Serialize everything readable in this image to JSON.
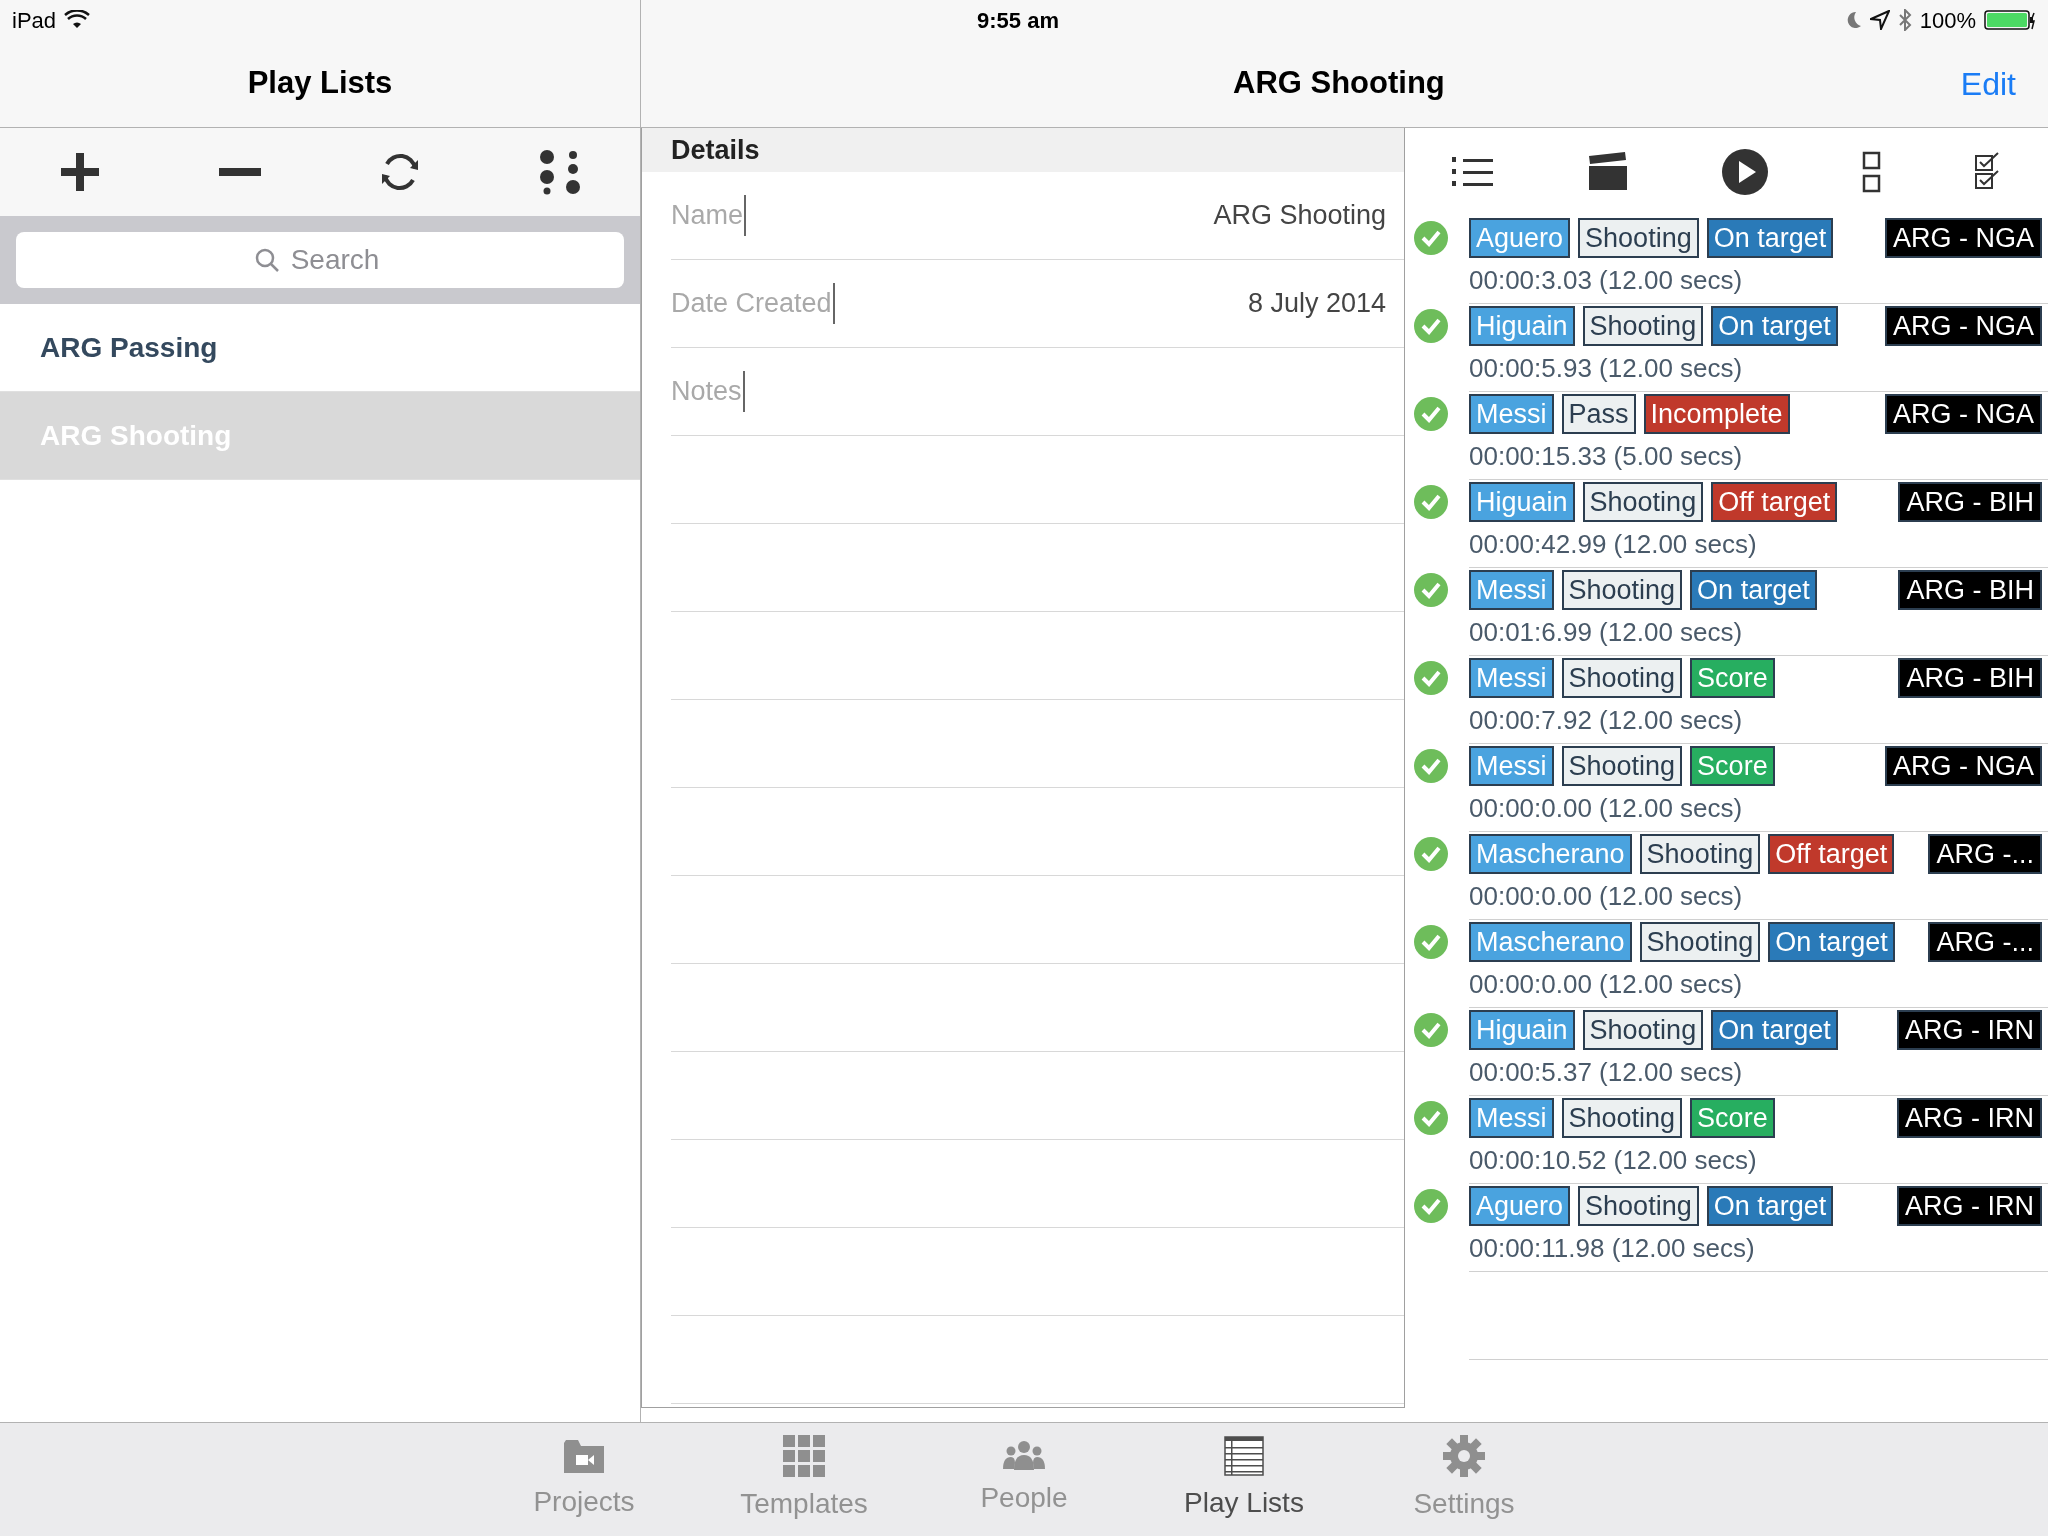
{
  "status_bar": {
    "device": "iPad",
    "time": "9:55 am",
    "battery": "100%"
  },
  "left_nav": {
    "title": "Play Lists"
  },
  "right_nav": {
    "title": "ARG Shooting",
    "edit": "Edit"
  },
  "search": {
    "placeholder": "Search"
  },
  "playlists": [
    {
      "label": "ARG Passing",
      "selected": false
    },
    {
      "label": "ARG Shooting",
      "selected": true
    }
  ],
  "details": {
    "header": "Details",
    "fields": [
      {
        "label": "Name",
        "value": "ARG Shooting"
      },
      {
        "label": "Date Created",
        "value": "8 July 2014"
      },
      {
        "label": "Notes"
      }
    ]
  },
  "events": [
    {
      "checked": true,
      "tags": [
        {
          "kind": "player",
          "text": "Aguero"
        },
        {
          "kind": "action",
          "text": "Shooting"
        },
        {
          "kind": "result",
          "text": "On target",
          "color": "#2a7ab8"
        }
      ],
      "match": "ARG - NGA",
      "time": "00:00:3.03 (12.00 secs)"
    },
    {
      "checked": true,
      "tags": [
        {
          "kind": "player",
          "text": "Higuain"
        },
        {
          "kind": "action",
          "text": "Shooting"
        },
        {
          "kind": "result",
          "text": "On target",
          "color": "#2a7ab8"
        }
      ],
      "match": "ARG - NGA",
      "time": "00:00:5.93 (12.00 secs)"
    },
    {
      "checked": true,
      "tags": [
        {
          "kind": "player",
          "text": "Messi"
        },
        {
          "kind": "action",
          "text": "Pass"
        },
        {
          "kind": "result",
          "text": "Incomplete",
          "color": "#c0392b"
        }
      ],
      "match": "ARG - NGA",
      "time": "00:00:15.33 (5.00 secs)"
    },
    {
      "checked": true,
      "tags": [
        {
          "kind": "player",
          "text": "Higuain"
        },
        {
          "kind": "action",
          "text": "Shooting"
        },
        {
          "kind": "result",
          "text": "Off target",
          "color": "#c0392b"
        }
      ],
      "match": "ARG - BIH",
      "time": "00:00:42.99 (12.00 secs)"
    },
    {
      "checked": true,
      "tags": [
        {
          "kind": "player",
          "text": "Messi"
        },
        {
          "kind": "action",
          "text": "Shooting"
        },
        {
          "kind": "result",
          "text": "On target",
          "color": "#2a7ab8"
        }
      ],
      "match": "ARG - BIH",
      "time": "00:01:6.99 (12.00 secs)"
    },
    {
      "checked": true,
      "tags": [
        {
          "kind": "player",
          "text": "Messi"
        },
        {
          "kind": "action",
          "text": "Shooting"
        },
        {
          "kind": "result",
          "text": "Score",
          "color": "#27ae60"
        }
      ],
      "match": "ARG - BIH",
      "time": "00:00:7.92 (12.00 secs)"
    },
    {
      "checked": true,
      "tags": [
        {
          "kind": "player",
          "text": "Messi"
        },
        {
          "kind": "action",
          "text": "Shooting"
        },
        {
          "kind": "result",
          "text": "Score",
          "color": "#27ae60"
        }
      ],
      "match": "ARG - NGA",
      "time": "00:00:0.00 (12.00 secs)"
    },
    {
      "checked": true,
      "tags": [
        {
          "kind": "player",
          "text": "Mascherano"
        },
        {
          "kind": "action",
          "text": "Shooting"
        },
        {
          "kind": "result",
          "text": "Off target",
          "color": "#c0392b"
        }
      ],
      "match": "ARG -...",
      "time": "00:00:0.00 (12.00 secs)"
    },
    {
      "checked": true,
      "tags": [
        {
          "kind": "player",
          "text": "Mascherano"
        },
        {
          "kind": "action",
          "text": "Shooting"
        },
        {
          "kind": "result",
          "text": "On target",
          "color": "#2a7ab8"
        }
      ],
      "match": "ARG -...",
      "time": "00:00:0.00 (12.00 secs)"
    },
    {
      "checked": true,
      "tags": [
        {
          "kind": "player",
          "text": "Higuain"
        },
        {
          "kind": "action",
          "text": "Shooting"
        },
        {
          "kind": "result",
          "text": "On target",
          "color": "#2a7ab8"
        }
      ],
      "match": "ARG - IRN",
      "time": "00:00:5.37 (12.00 secs)"
    },
    {
      "checked": true,
      "tags": [
        {
          "kind": "player",
          "text": "Messi"
        },
        {
          "kind": "action",
          "text": "Shooting"
        },
        {
          "kind": "result",
          "text": "Score",
          "color": "#27ae60"
        }
      ],
      "match": "ARG - IRN",
      "time": "00:00:10.52 (12.00 secs)"
    },
    {
      "checked": true,
      "tags": [
        {
          "kind": "player",
          "text": "Aguero"
        },
        {
          "kind": "action",
          "text": "Shooting"
        },
        {
          "kind": "result",
          "text": "On target",
          "color": "#2a7ab8"
        }
      ],
      "match": "ARG - IRN",
      "time": "00:00:11.98 (12.00 secs)"
    }
  ],
  "tab_bar": [
    {
      "kind": "projects",
      "label": "Projects",
      "selected": false
    },
    {
      "kind": "templates",
      "label": "Templates",
      "selected": false
    },
    {
      "kind": "people",
      "label": "People",
      "selected": false
    },
    {
      "kind": "playlists",
      "label": "Play Lists",
      "selected": true
    },
    {
      "kind": "settings",
      "label": "Settings",
      "selected": false
    }
  ]
}
